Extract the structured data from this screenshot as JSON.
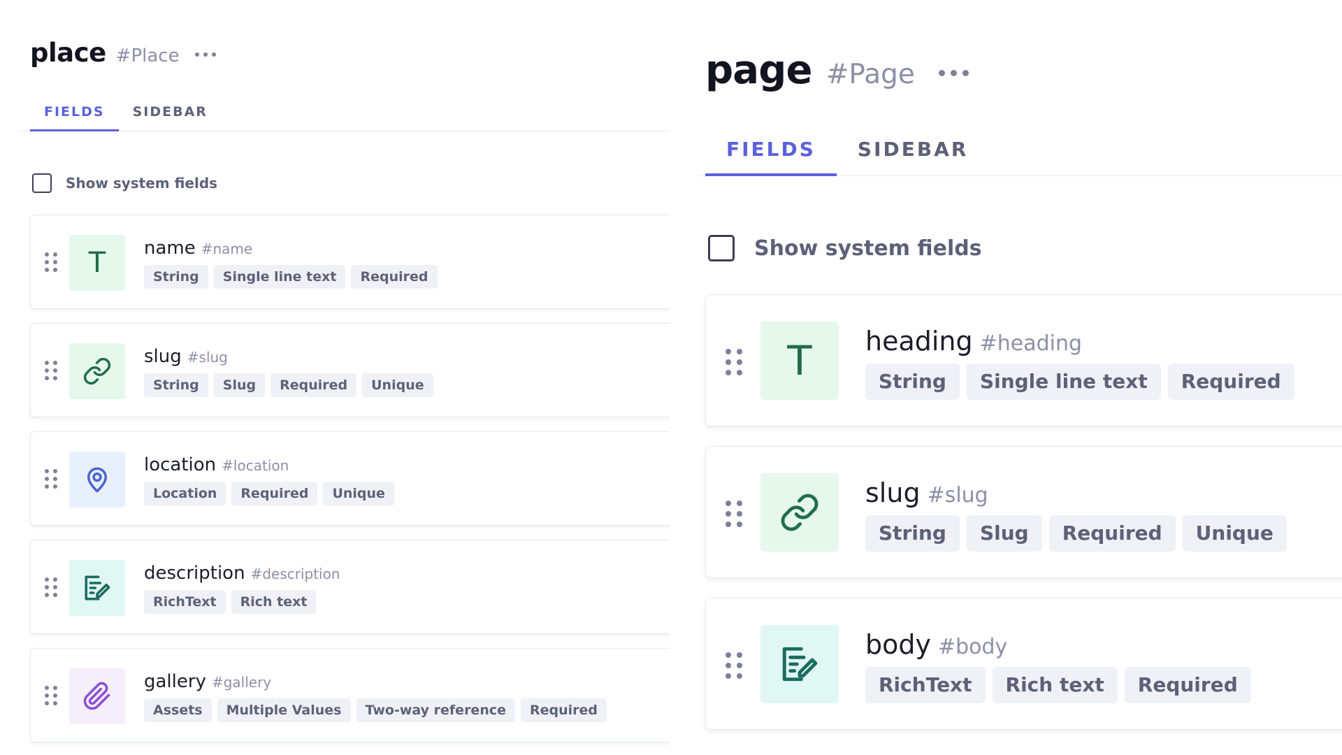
{
  "left": {
    "model_name": "place",
    "model_api_id": "#Place",
    "tabs": [
      {
        "label": "FIELDS",
        "active": true
      },
      {
        "label": "SIDEBAR",
        "active": false
      }
    ],
    "show_system_fields": {
      "label": "Show system fields",
      "checked": false
    },
    "fields": [
      {
        "name": "name",
        "api_id": "#name",
        "icon": "text-t-icon",
        "icon_bg": "green",
        "tags": [
          "String",
          "Single line text",
          "Required"
        ]
      },
      {
        "name": "slug",
        "api_id": "#slug",
        "icon": "link-icon",
        "icon_bg": "green",
        "tags": [
          "String",
          "Slug",
          "Required",
          "Unique"
        ]
      },
      {
        "name": "location",
        "api_id": "#location",
        "icon": "location-pin-icon",
        "icon_bg": "blue",
        "tags": [
          "Location",
          "Required",
          "Unique"
        ]
      },
      {
        "name": "description",
        "api_id": "#description",
        "icon": "rich-text-edit-icon",
        "icon_bg": "teal",
        "tags": [
          "RichText",
          "Rich text"
        ]
      },
      {
        "name": "gallery",
        "api_id": "#gallery",
        "icon": "paperclip-icon",
        "icon_bg": "purple",
        "tags": [
          "Assets",
          "Multiple Values",
          "Two-way reference",
          "Required"
        ]
      }
    ]
  },
  "right": {
    "model_name": "page",
    "model_api_id": "#Page",
    "tabs": [
      {
        "label": "FIELDS",
        "active": true
      },
      {
        "label": "SIDEBAR",
        "active": false
      }
    ],
    "show_system_fields": {
      "label": "Show system fields",
      "checked": false
    },
    "fields": [
      {
        "name": "heading",
        "api_id": "#heading",
        "icon": "text-t-icon",
        "icon_bg": "green",
        "tags": [
          "String",
          "Single line text",
          "Required"
        ]
      },
      {
        "name": "slug",
        "api_id": "#slug",
        "icon": "link-icon",
        "icon_bg": "green",
        "tags": [
          "String",
          "Slug",
          "Required",
          "Unique"
        ]
      },
      {
        "name": "body",
        "api_id": "#body",
        "icon": "rich-text-edit-icon",
        "icon_bg": "teal",
        "tags": [
          "RichText",
          "Rich text",
          "Required"
        ]
      }
    ]
  },
  "colors": {
    "accent": "#5b61dc",
    "tag_bg": "#f0f1f6",
    "tag_text": "#5d6178",
    "muted": "#8c90a6",
    "string_icon": "#1f6e46",
    "location_icon": "#4c63d2",
    "richtext_icon": "#1a6b5e",
    "asset_icon": "#8b4fd1"
  }
}
